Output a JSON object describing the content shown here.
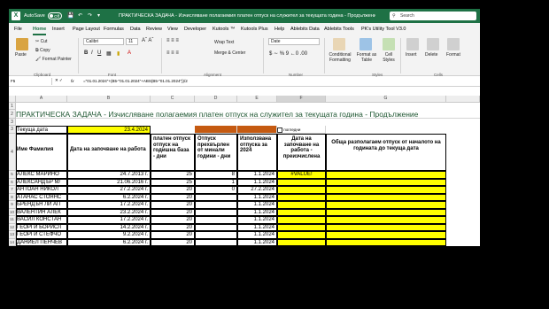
{
  "titlebar": {
    "app_icon": "X",
    "autosave": "AutoSave",
    "toggle": "Off",
    "document": "ПРАКТИЧЕСКА ЗАДАЧА - Изчисляване полагаемия платен отпуск на служител за текущата година - Продължение.xlsx",
    "search": "Search"
  },
  "menu": [
    "File",
    "Home",
    "Insert",
    "Page Layout",
    "Formulas",
    "Data",
    "Review",
    "View",
    "Developer",
    "Kutools ™",
    "Kutools Plus",
    "Help",
    "Ablebits Data",
    "Ablebits Tools",
    "PK's Utility Tool V3.0"
  ],
  "ribbon": {
    "paste": "Paste",
    "cut": "Cut",
    "copy": "Copy",
    "format_painter": "Format Painter",
    "font_name": "Calibri",
    "font_size": "11",
    "wrap_text": "Wrap Text",
    "merge_center": "Merge & Center",
    "number_format": "Date",
    "conditional_formatting": "Conditional Formatting",
    "format_as_table": "Format as Table",
    "cell_styles": "Cell Styles",
    "insert": "Insert",
    "delete": "Delete",
    "format": "Format",
    "groups": {
      "clipboard": "Clipboard",
      "font": "Font",
      "alignment": "Alignment",
      "number": "Number",
      "styles": "Styles",
      "cells": "Cells"
    }
  },
  "formula_bar": {
    "name_box": "F5",
    "fx": "fx",
    "formula": "=\"01.01.2024\"+(B5-\"01.01.2024\"+ABS(B5-\"01.01.2024\"))/2"
  },
  "columns": [
    "A",
    "B",
    "C",
    "D",
    "E",
    "F",
    "G"
  ],
  "title_row": "ПРАКТИЧЕСКА ЗАДАЧА - Изчисляване полагаемия платен отпуск на служител за текущата година - Продължение",
  "current_date_label": "Текуща дата",
  "current_date": "23.4.2024",
  "checkbox_label": "погледни",
  "headers": {
    "a": "Име Фамилия",
    "b": "Дата на започване на работа",
    "c": "платен отпуск отпуск на годишна база - дни",
    "d": "Отпуск прехвърлен от минали години - дни",
    "e": "Използвана отпуска за 2024",
    "f": "Дата на започване на работа - преизчислена",
    "g": "Обща разполагаем отпуск от началото на годината до текуща дата"
  },
  "rows": [
    {
      "n": "5",
      "a": "АЛЕКС МАРИНО",
      "b": "24.7.2013 г.",
      "c": "25",
      "d": "8",
      "e": "1.1.2024",
      "f": "#VALUE!"
    },
    {
      "n": "6",
      "a": "АЛЕКСАНДЪР М/",
      "b": "21.06.2016 г.",
      "c": "25",
      "d": "1",
      "e": "1.1.2024",
      "f": ""
    },
    {
      "n": "7",
      "a": "АНТОАН НИКОЛ",
      "b": "27.2.2024 г.",
      "c": "20",
      "d": "0",
      "e": "27.2.2024",
      "f": ""
    },
    {
      "n": "8",
      "a": "АТАНАС СТОЯНС",
      "b": "6.2.2024 г.",
      "c": "20",
      "d": "",
      "e": "1.1.2024",
      "f": ""
    },
    {
      "n": "9",
      "a": "БРЕНДЪН ЛИ АП",
      "b": "17.2.2024 г.",
      "c": "20",
      "d": "",
      "e": "1.1.2024",
      "f": ""
    },
    {
      "n": "10",
      "a": "ВАЛЕНТИН АЛЕК",
      "b": "23.2.2024 г.",
      "c": "20",
      "d": "",
      "e": "1.1.2024",
      "f": ""
    },
    {
      "n": "11",
      "a": "ВАСИЛ КОНСТАН",
      "b": "17.2.2024 г.",
      "c": "20",
      "d": "",
      "e": "1.1.2024",
      "f": ""
    },
    {
      "n": "12",
      "a": "ГЕОРГИ БОРИСЛ",
      "b": "14.2.2024 г.",
      "c": "20",
      "d": "",
      "e": "1.1.2024",
      "f": ""
    },
    {
      "n": "13",
      "a": "ГЕОРГИ СТЕФЧО",
      "b": "9.2.2024 г.",
      "c": "20",
      "d": "",
      "e": "1.1.2024",
      "f": ""
    },
    {
      "n": "14",
      "a": "ДАНИЕЛ ПЕНЧЕВ",
      "b": "6.2.2024 г.",
      "c": "20",
      "d": "",
      "e": "1.1.2024",
      "f": ""
    }
  ],
  "colors": {
    "green": "#1e7145",
    "yellow": "#ffff00",
    "orange": "#c55a11",
    "blue_tag": "#5b9bd5"
  }
}
